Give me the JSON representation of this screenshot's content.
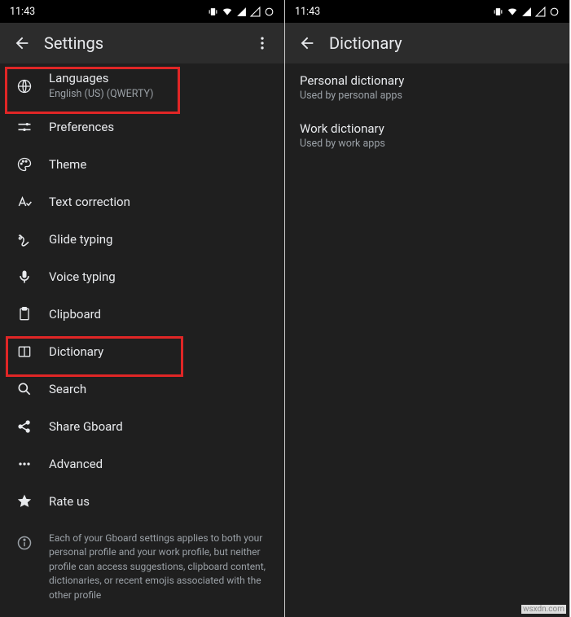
{
  "status": {
    "time": "11:43"
  },
  "left": {
    "appbar_title": "Settings",
    "items": {
      "languages": {
        "title": "Languages",
        "sub": "English (US) (QWERTY)"
      },
      "preferences": {
        "title": "Preferences"
      },
      "theme": {
        "title": "Theme"
      },
      "text_correction": {
        "title": "Text correction"
      },
      "glide_typing": {
        "title": "Glide typing"
      },
      "voice_typing": {
        "title": "Voice typing"
      },
      "clipboard": {
        "title": "Clipboard"
      },
      "dictionary": {
        "title": "Dictionary"
      },
      "search": {
        "title": "Search"
      },
      "share": {
        "title": "Share Gboard"
      },
      "advanced": {
        "title": "Advanced"
      },
      "rate": {
        "title": "Rate us"
      }
    },
    "info": "Each of your Gboard settings applies to both your personal profile and your work profile, but neither profile can access suggestions, clipboard content, dictionaries, or recent emojis associated with the other profile"
  },
  "right": {
    "appbar_title": "Dictionary",
    "personal": {
      "title": "Personal dictionary",
      "sub": "Used by personal apps"
    },
    "work": {
      "title": "Work dictionary",
      "sub": "Used by work apps"
    }
  },
  "watermark": "wsxdn.com"
}
